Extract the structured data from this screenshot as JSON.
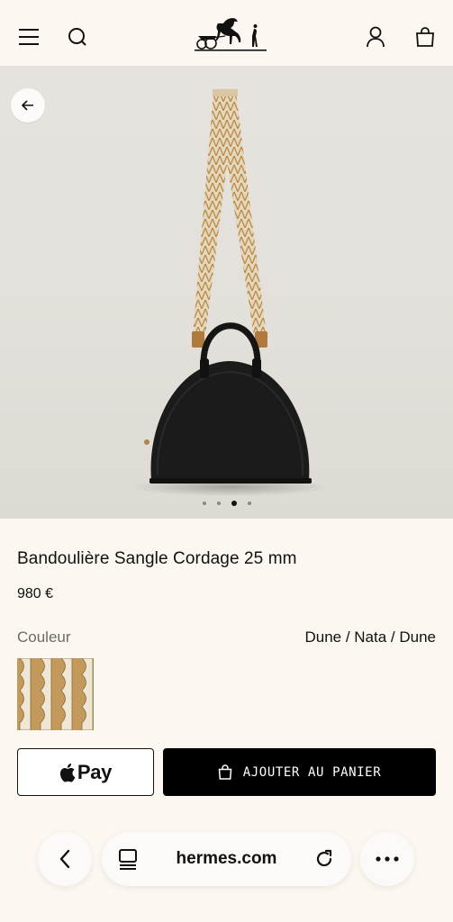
{
  "header": {
    "menu_icon": "hamburger-menu-icon",
    "search_icon": "search-icon",
    "logo": "hermes-carriage-logo",
    "account_icon": "person-icon",
    "bag_icon": "shopping-bag-icon"
  },
  "gallery": {
    "back_icon": "arrow-left-icon",
    "slide_count": 4,
    "active_slide": 3
  },
  "product": {
    "title": "Bandoulière Sangle Cordage 25 mm",
    "price": "980 €",
    "color_label": "Couleur",
    "color_value": "Dune / Nata / Dune"
  },
  "actions": {
    "apple_pay_label": "Pay",
    "add_to_cart_label": "AJOUTER AU PANIER"
  },
  "browser": {
    "domain": "hermes.com",
    "back_icon": "chevron-left-icon",
    "tabs_icon": "tabs-icon",
    "reload_icon": "reload-icon",
    "more_icon": "more-dots-icon"
  },
  "colors": {
    "page_bg": "#fcf8f1",
    "button_black": "#000000",
    "strap_beige": "#d9c7a3",
    "strap_tan": "#b98a4a"
  }
}
